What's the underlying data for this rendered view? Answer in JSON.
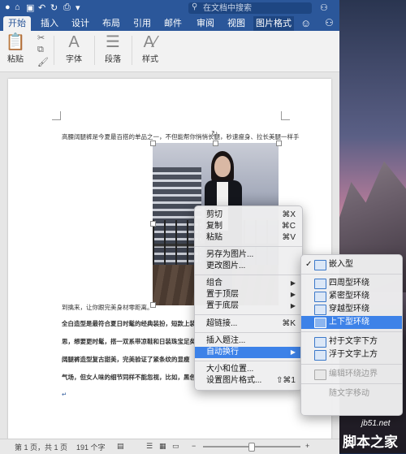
{
  "titlebar": {
    "search_placeholder": "在文档中搜索"
  },
  "ribbon_tabs": [
    {
      "label": "开始",
      "active": true
    },
    {
      "label": "插入"
    },
    {
      "label": "设计"
    },
    {
      "label": "布局"
    },
    {
      "label": "引用"
    },
    {
      "label": "邮件"
    },
    {
      "label": "审阅"
    },
    {
      "label": "视图"
    },
    {
      "label": "图片格式"
    }
  ],
  "ribbon": {
    "paste_label": "粘贴",
    "font_label": "字体",
    "paragraph_label": "段落",
    "styles_label": "样式"
  },
  "document": {
    "line1": "高腰阔腿裤是今夏最百搭的单品之一，不但能帮你悄悄长腿，秒速瘦身、拉长美腿一样手",
    "line2": "到擒来，让你跟完美身材零距离。",
    "line3": "全白造型是最符合夏日时髦的经典装扮，短款上装",
    "line4": "思，想要更时髦，搭一双系带凉鞋和日装珠宝足矣",
    "line5": "阔腿裤造型复古甜美，完美验证了紧条纹的显瘦",
    "line6": "气场，但女人味的细节同样不能忽视，比如，黑色",
    "para_mark": "↵"
  },
  "context_menu": {
    "items": [
      {
        "label": "剪切",
        "shortcut": "⌘X"
      },
      {
        "label": "复制",
        "shortcut": "⌘C"
      },
      {
        "label": "粘贴",
        "shortcut": "⌘V"
      },
      {
        "label": "另存为图片..."
      },
      {
        "label": "更改图片..."
      },
      {
        "label": "组合",
        "submenu": true
      },
      {
        "label": "置于顶层",
        "submenu": true
      },
      {
        "label": "置于底层",
        "submenu": true
      },
      {
        "label": "超链接...",
        "shortcut": "⌘K"
      },
      {
        "label": "插入题注..."
      },
      {
        "label": "自动换行",
        "submenu": true,
        "highlighted": true
      },
      {
        "label": "大小和位置..."
      },
      {
        "label": "设置图片格式...",
        "shortcut": "⇧⌘1"
      }
    ]
  },
  "wrap_submenu": {
    "items": [
      {
        "label": "嵌入型",
        "checked": true
      },
      {
        "label": "四周型环绕"
      },
      {
        "label": "紧密型环绕"
      },
      {
        "label": "穿越型环绕"
      },
      {
        "label": "上下型环绕",
        "highlighted": true
      },
      {
        "label": "衬于文字下方"
      },
      {
        "label": "浮于文字上方"
      },
      {
        "label": "编辑环绕边界",
        "disabled": true
      },
      {
        "label": "随文字移动",
        "disabled": true
      }
    ]
  },
  "statusbar": {
    "page_info": "第 1 页，共 1 页",
    "word_count": "191 个字"
  },
  "watermark": {
    "site": "jb51.net",
    "name": "脚本之家"
  },
  "colors": {
    "accent": "#2b579a",
    "menu_highlight": "#3d82e8"
  }
}
